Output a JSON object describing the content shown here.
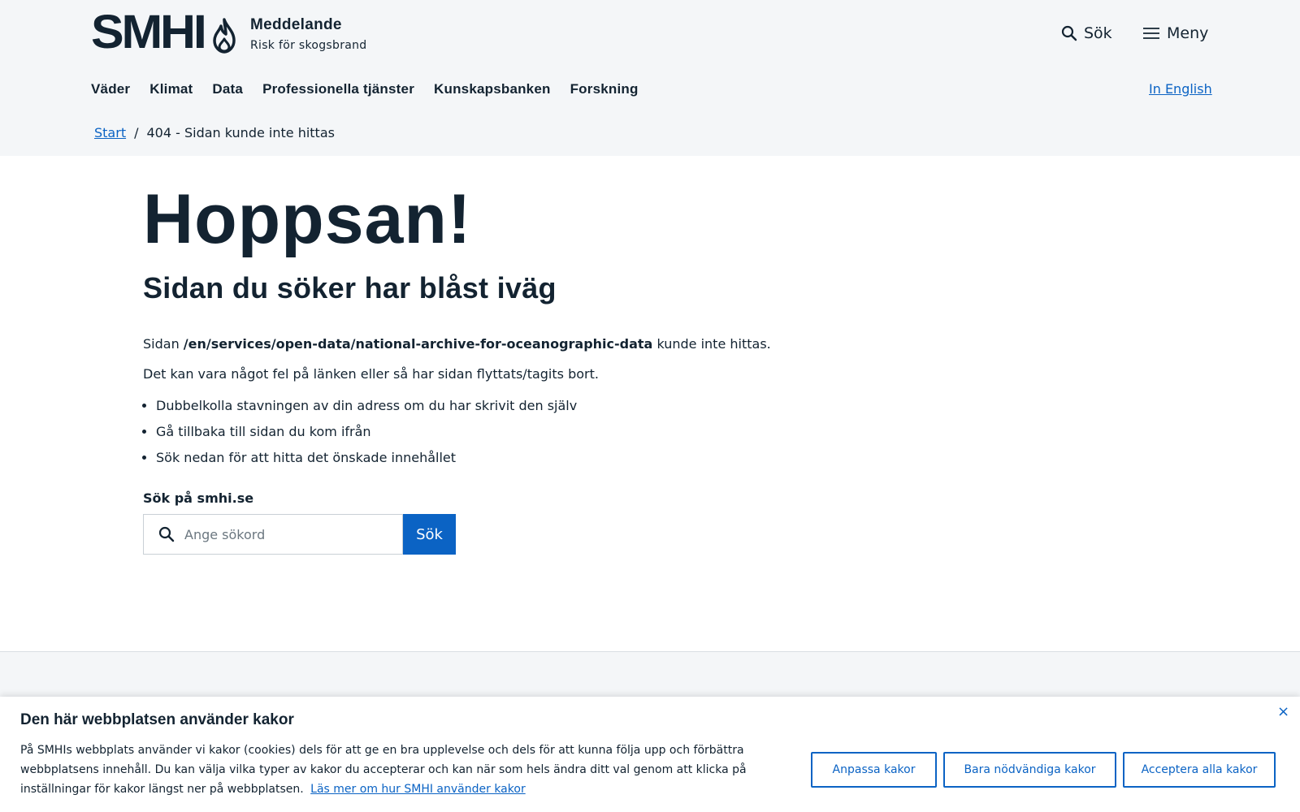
{
  "header": {
    "logo_text": "SMHI",
    "notice_title": "Meddelande",
    "notice_subtitle": "Risk för skogsbrand",
    "search_label": "Sök",
    "menu_label": "Meny",
    "flame_icon": "flame-icon",
    "search_icon": "search-icon",
    "menu_icon": "hamburger-icon"
  },
  "nav": {
    "items": [
      "Väder",
      "Klimat",
      "Data",
      "Professionella tjänster",
      "Kunskapsbanken",
      "Forskning"
    ],
    "lang_link": "In English"
  },
  "breadcrumb": {
    "home": "Start",
    "separator": "/",
    "current": "404 - Sidan kunde inte hittas"
  },
  "main": {
    "heading": "Hoppsan!",
    "subheading": "Sidan du söker har blåst iväg",
    "p1_prefix": "Sidan",
    "p1_path": "/en/services/open-data/national-archive-for-oceanographic-data",
    "p1_suffix": "kunde inte hittas.",
    "p2": "Det kan vara något fel på länken eller så har sidan flyttats/tagits bort.",
    "tips": [
      "Dubbelkolla stavningen av din adress om du har skrivit den själv",
      "Gå tillbaka till sidan du kom ifrån",
      "Sök nedan för att hitta det önskade innehållet"
    ],
    "search_label": "Sök på smhi.se",
    "search_placeholder": "Ange sökord",
    "search_button": "Sök"
  },
  "cookie": {
    "title": "Den här webbplatsen använder kakor",
    "text": "På SMHIs webbplats använder vi kakor (cookies) dels för att ge en bra upplevelse och dels för att kunna följa upp och förbättra webbplatsens innehåll. Du kan välja vilka typer av kakor du accepterar och kan när som hels ändra ditt val genom att klicka på inställningar för kakor längst ner på webbplatsen.",
    "link": "Läs mer om hur SMHI använder kakor",
    "btn_customize": "Anpassa kakor",
    "btn_necessary": "Bara nödvändiga kakor",
    "btn_accept": "Acceptera alla kakor",
    "close": "×"
  },
  "colors": {
    "accent": "#0b63c4",
    "text": "#132331",
    "band": "#f4f6f8"
  }
}
